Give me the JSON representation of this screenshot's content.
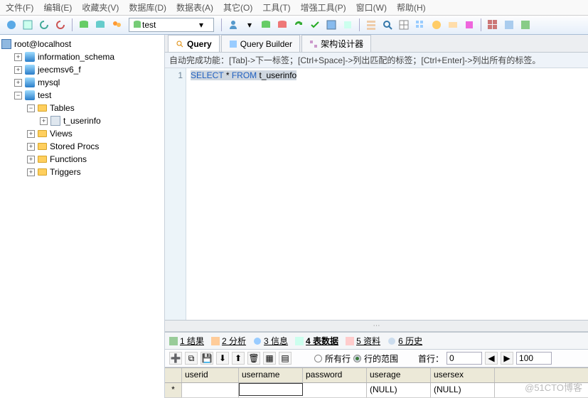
{
  "menu": [
    "文件(F)",
    "编辑(E)",
    "收藏夹(V)",
    "数据库(D)",
    "数据表(A)",
    "其它(O)",
    "工具(T)",
    "增强工具(P)",
    "窗口(W)",
    "帮助(H)"
  ],
  "db_dropdown": "test",
  "connection": "root@localhost",
  "tree": {
    "db1": "information_schema",
    "db2": "jeecmsv6_f",
    "db3": "mysql",
    "db4": "test",
    "tables": "Tables",
    "table1": "t_userinfo",
    "views": "Views",
    "procs": "Stored Procs",
    "funcs": "Functions",
    "trigs": "Triggers"
  },
  "tabs": {
    "query": "Query",
    "builder": "Query Builder",
    "designer": "架构设计器"
  },
  "hint": "自动完成功能：[Tab]->下一标签；[Ctrl+Space]->列出匹配的标签；[Ctrl+Enter]->列出所有的标签。",
  "sql": {
    "line": "1",
    "k1": "SELECT",
    "star": "*",
    "k2": "FROM",
    "tbl": "t_userinfo"
  },
  "rtabs": {
    "r1": "1 结果",
    "r2": "2 分析",
    "r3": "3 信息",
    "r4": "4 表数据",
    "r5": "5 资料",
    "r6": "6 历史"
  },
  "filter": {
    "all": "所有行",
    "range": "行的范围",
    "first": "首行：",
    "first_v": "0",
    "count_v": "100"
  },
  "grid": {
    "cols": [
      "userid",
      "username",
      "password",
      "userage",
      "usersex"
    ],
    "rowmark": "*",
    "null": "(NULL)"
  },
  "watermark": "@51CTO博客"
}
